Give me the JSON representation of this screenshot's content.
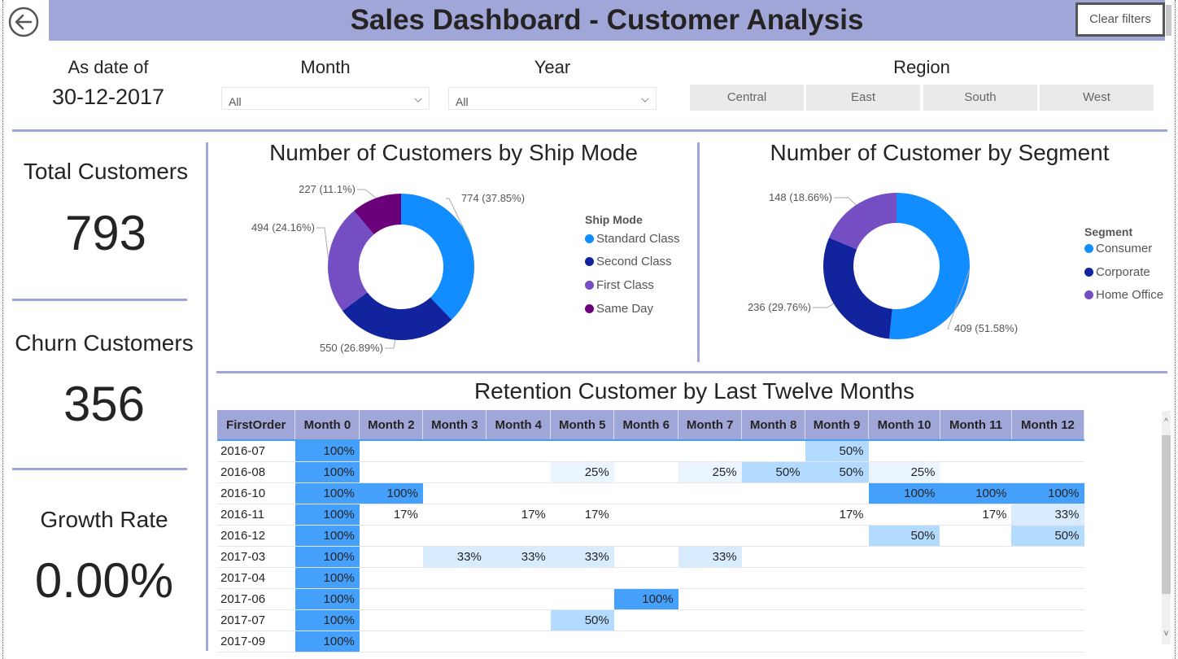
{
  "header": {
    "title": "Sales Dashboard - Customer Analysis",
    "back_icon": "arrow-left-circle-icon",
    "clear_filters_label": "Clear filters"
  },
  "filters": {
    "as_date_label": "As date of",
    "as_date_value": "30-12-2017",
    "month_label": "Month",
    "month_value": "All",
    "year_label": "Year",
    "year_value": "All",
    "region_label": "Region",
    "region_options": [
      "Central",
      "East",
      "South",
      "West"
    ]
  },
  "kpis": {
    "total_customers_label": "Total Customers",
    "total_customers_value": "793",
    "churn_customers_label": "Churn Customers",
    "churn_customers_value": "356",
    "growth_rate_label": "Growth Rate",
    "growth_rate_value": "0.00%"
  },
  "colors": {
    "accent": "#a1a6d8",
    "standard_class": "#118dff",
    "second_class": "#12239e",
    "first_class": "#744ec2",
    "same_day": "#6b007b",
    "heat_full": "#45a0fc",
    "heat_mid": "#b3daff",
    "heat_low": "#d9ecff",
    "heat_vlow": "#ebf5ff"
  },
  "chart_data": [
    {
      "type": "pie",
      "title": "Number of Customers by Ship Mode",
      "legend_title": "Ship Mode",
      "legend_position": "right",
      "categories": [
        "Standard Class",
        "Second Class",
        "First Class",
        "Same Day"
      ],
      "values": [
        774,
        550,
        494,
        227
      ],
      "percents": [
        "37.85%",
        "26.89%",
        "24.16%",
        "11.1%"
      ],
      "labels": [
        "774 (37.85%)",
        "550 (26.89%)",
        "494 (24.16%)",
        "227 (11.1%)"
      ]
    },
    {
      "type": "pie",
      "title": "Number of Customer by Segment",
      "legend_title": "Segment",
      "legend_position": "right",
      "categories": [
        "Consumer",
        "Corporate",
        "Home Office"
      ],
      "values": [
        409,
        236,
        148
      ],
      "percents": [
        "51.58%",
        "29.76%",
        "18.66%"
      ],
      "labels": [
        "409 (51.58%)",
        "236 (29.76%)",
        "148 (18.66%)"
      ]
    },
    {
      "type": "table",
      "title": "Retention Customer by Last Twelve Months",
      "columns": [
        "FirstOrder",
        "Month 0",
        "Month 2",
        "Month 3",
        "Month 4",
        "Month 5",
        "Month 6",
        "Month 7",
        "Month 8",
        "Month 9",
        "Month 10",
        "Month 11",
        "Month 12"
      ],
      "rows": [
        [
          "2016-07",
          "100%",
          "",
          "",
          "",
          "",
          "",
          "",
          "",
          "50%",
          "",
          "",
          ""
        ],
        [
          "2016-08",
          "100%",
          "",
          "",
          "",
          "25%",
          "",
          "25%",
          "50%",
          "50%",
          "25%",
          "",
          ""
        ],
        [
          "2016-10",
          "100%",
          "100%",
          "",
          "",
          "",
          "",
          "",
          "",
          "",
          "100%",
          "100%",
          "100%"
        ],
        [
          "2016-11",
          "100%",
          "17%",
          "",
          "17%",
          "17%",
          "",
          "",
          "",
          "17%",
          "",
          "17%",
          "33%"
        ],
        [
          "2016-12",
          "100%",
          "",
          "",
          "",
          "",
          "",
          "",
          "",
          "",
          "50%",
          "",
          "50%"
        ],
        [
          "2017-03",
          "100%",
          "",
          "33%",
          "33%",
          "33%",
          "",
          "33%",
          "",
          "",
          "",
          "",
          ""
        ],
        [
          "2017-04",
          "100%",
          "",
          "",
          "",
          "",
          "",
          "",
          "",
          "",
          "",
          "",
          ""
        ],
        [
          "2017-06",
          "100%",
          "",
          "",
          "",
          "",
          "100%",
          "",
          "",
          "",
          "",
          "",
          ""
        ],
        [
          "2017-07",
          "100%",
          "",
          "",
          "",
          "50%",
          "",
          "",
          "",
          "",
          "",
          "",
          ""
        ],
        [
          "2017-09",
          "100%",
          "",
          "",
          "",
          "",
          "",
          "",
          "",
          "",
          "",
          "",
          ""
        ]
      ]
    }
  ]
}
